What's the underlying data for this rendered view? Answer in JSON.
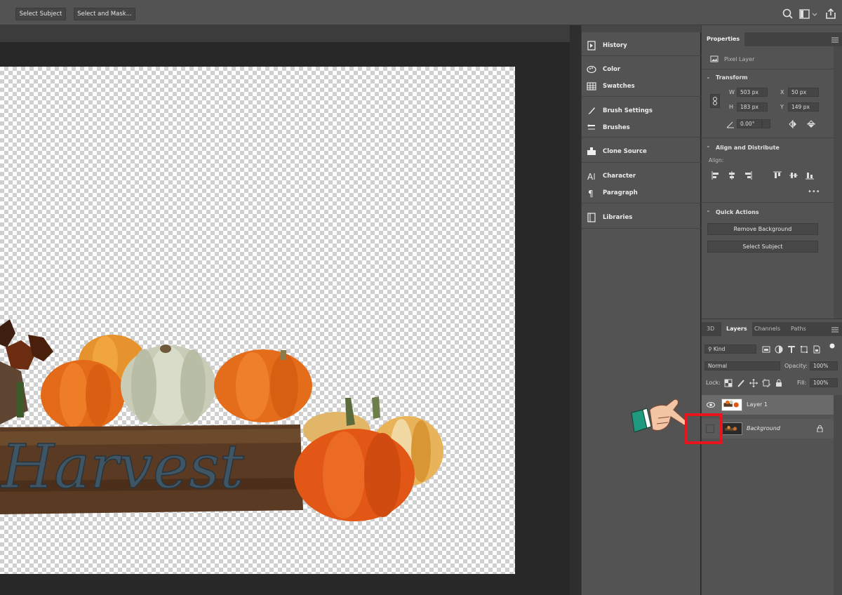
{
  "options_bar": {
    "select_subject": "Select Subject",
    "select_and_mask": "Select and Mask..."
  },
  "dock": {
    "items": [
      {
        "label": "History",
        "icon": "history-icon"
      },
      {
        "label": "Color",
        "icon": "color-icon"
      },
      {
        "label": "Swatches",
        "icon": "swatches-icon"
      },
      {
        "label": "Brush Settings",
        "icon": "brush-settings-icon"
      },
      {
        "label": "Brushes",
        "icon": "brushes-icon"
      },
      {
        "label": "Clone Source",
        "icon": "clone-source-icon"
      },
      {
        "label": "Character",
        "icon": "character-icon"
      },
      {
        "label": "Paragraph",
        "icon": "paragraph-icon"
      },
      {
        "label": "Libraries",
        "icon": "libraries-icon"
      }
    ]
  },
  "properties": {
    "tab": "Properties",
    "layer_type": "Pixel Layer",
    "transform": {
      "title": "Transform",
      "w_label": "W",
      "w": "503 px",
      "h_label": "H",
      "h": "183 px",
      "x_label": "X",
      "x": "50 px",
      "y_label": "Y",
      "y": "149 px",
      "angle": "0.00°"
    },
    "align": {
      "title": "Align and Distribute",
      "align_label": "Align:"
    },
    "quick_actions": {
      "title": "Quick Actions",
      "remove_background": "Remove Background",
      "select_subject": "Select Subject"
    }
  },
  "layers": {
    "tabs": [
      "3D",
      "Layers",
      "Channels",
      "Paths"
    ],
    "filter": "Kind",
    "blend_mode": "Normal",
    "opacity_label": "Opacity:",
    "opacity": "100%",
    "lock_label": "Lock:",
    "fill_label": "Fill:",
    "fill": "100%",
    "rows": [
      {
        "name": "Layer 1",
        "visible": true
      },
      {
        "name": "Background",
        "visible": false,
        "locked": true
      }
    ]
  },
  "artwork": {
    "sign_text": "Harvest"
  },
  "colors": {
    "panel": "#535353",
    "canvas_bg": "#282828",
    "highlight_box": "#e8141e"
  }
}
